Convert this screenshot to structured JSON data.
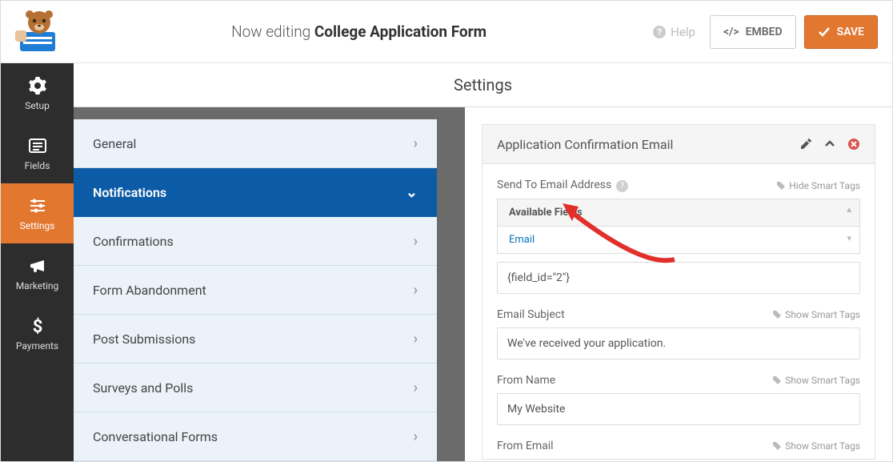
{
  "header": {
    "editing_prefix": "Now editing ",
    "form_name": "College Application Form",
    "help": "Help",
    "embed": "EMBED",
    "save": "SAVE"
  },
  "nav": {
    "setup": "Setup",
    "fields": "Fields",
    "settings": "Settings",
    "marketing": "Marketing",
    "payments": "Payments"
  },
  "content_title": "Settings",
  "sidebar": {
    "items": [
      "General",
      "Notifications",
      "Confirmations",
      "Form Abandonment",
      "Post Submissions",
      "Surveys and Polls",
      "Conversational Forms"
    ]
  },
  "card": {
    "title": "Application Confirmation Email",
    "send_to_label": "Send To Email Address",
    "hide_smart": "Hide Smart Tags",
    "show_smart": "Show Smart Tags",
    "available_fields": "Available Fields",
    "email_option": "Email",
    "send_to_value": "{field_id=\"2\"}",
    "subject_label": "Email Subject",
    "subject_value": "We've received your application.",
    "from_name_label": "From Name",
    "from_name_value": "My Website",
    "from_email_label": "From Email"
  }
}
